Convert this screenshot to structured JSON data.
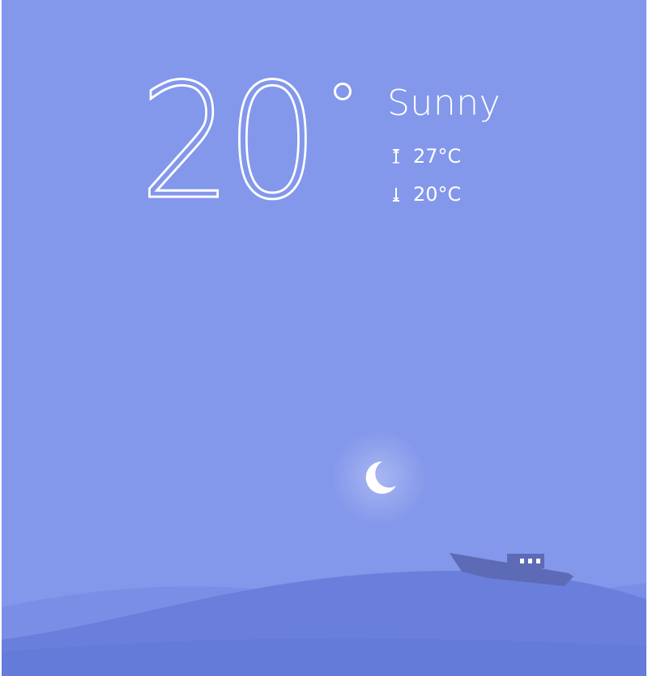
{
  "weather": {
    "temperature": "20",
    "condition": "Sunny",
    "high": "27°C",
    "low": "20°C"
  },
  "icons": {
    "high": "arrow-up-thermometer-icon",
    "low": "arrow-down-thermometer-icon",
    "moon": "crescent-moon-icon",
    "boat": "boat-icon"
  },
  "colors": {
    "sky": "#8397eb",
    "wave_light": "#7b8ee6",
    "wave_dark": "#6a7fdc",
    "boat": "#5d6ab6",
    "text": "#ffffff"
  }
}
